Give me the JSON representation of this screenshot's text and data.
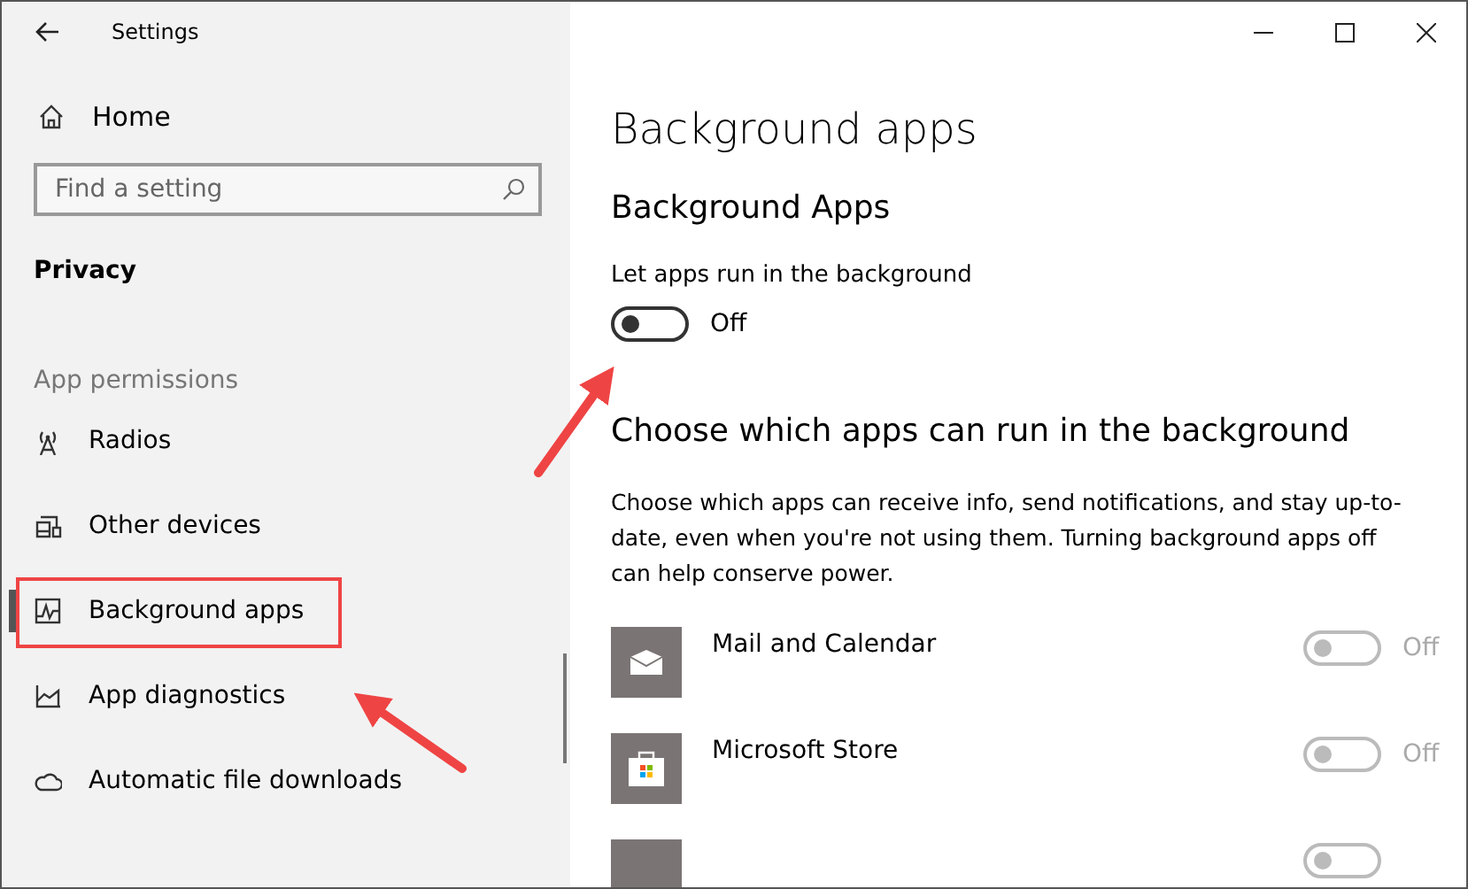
{
  "window": {
    "title": "Settings"
  },
  "sidebar": {
    "home": "Home",
    "search": {
      "placeholder": "Find a setting"
    },
    "section": "Privacy",
    "group": "App permissions",
    "items": [
      {
        "label": "Radios",
        "kind": "radios",
        "selected": false,
        "highlighted": false
      },
      {
        "label": "Other devices",
        "kind": "devices",
        "selected": false,
        "highlighted": false
      },
      {
        "label": "Background apps",
        "kind": "background",
        "selected": true,
        "highlighted": true
      },
      {
        "label": "App diagnostics",
        "kind": "diagnostics",
        "selected": false,
        "highlighted": false
      },
      {
        "label": "Automatic file downloads",
        "kind": "cloud",
        "selected": false,
        "highlighted": false
      }
    ]
  },
  "main": {
    "title": "Background apps",
    "subtitle": "Background Apps",
    "setting": {
      "label": "Let apps run in the background",
      "on": false,
      "state_text": "Off"
    },
    "apps_heading": "Choose which apps can run in the background",
    "apps_description": "Choose which apps can receive info, send notifications, and stay up-to-date, even when you're not using them. Turning background apps off can help conserve power.",
    "apps": [
      {
        "name": "Mail and Calendar",
        "kind": "mail",
        "on": false,
        "disabled": true,
        "state_text": "Off"
      },
      {
        "name": "Microsoft Store",
        "kind": "store",
        "on": false,
        "disabled": true,
        "state_text": "Off"
      },
      {
        "kind": "blank",
        "on": false,
        "disabled": true
      }
    ]
  }
}
